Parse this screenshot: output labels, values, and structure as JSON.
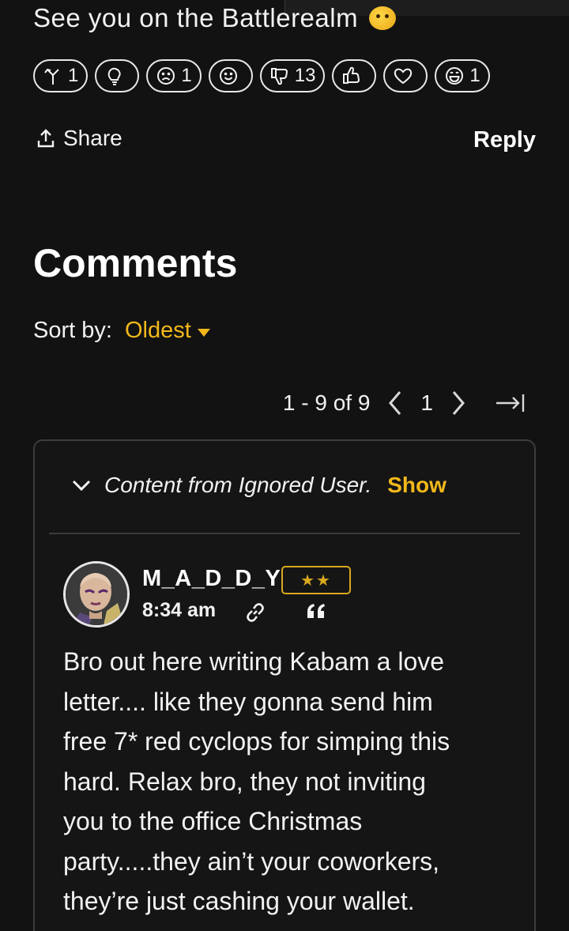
{
  "post": {
    "tail_text": "See you on the Battlerealm",
    "emoji": "partying-face-emoji"
  },
  "reactions": [
    {
      "name": "insightful",
      "icon": "arrow-fork-icon",
      "count": "1"
    },
    {
      "name": "idea",
      "icon": "lightbulb-icon",
      "count": ""
    },
    {
      "name": "sad",
      "icon": "frown-face-icon",
      "count": "1"
    },
    {
      "name": "smile",
      "icon": "smile-face-icon",
      "count": ""
    },
    {
      "name": "disagree",
      "icon": "thumbs-down-icon",
      "count": "13"
    },
    {
      "name": "like",
      "icon": "thumbs-up-icon",
      "count": ""
    },
    {
      "name": "love",
      "icon": "heart-icon",
      "count": ""
    },
    {
      "name": "lol",
      "icon": "grin-face-icon",
      "count": "1"
    }
  ],
  "actions": {
    "share_label": "Share",
    "reply_label": "Reply"
  },
  "comments": {
    "title": "Comments",
    "sort_label": "Sort by:",
    "sort_value": "Oldest"
  },
  "pagination": {
    "range": "1 - 9 of 9",
    "current_page": "1"
  },
  "ignored": {
    "text": "Content from Ignored User.",
    "show_label": "Show"
  },
  "comment": {
    "username": "M_A_D_D_Y",
    "rank": "★★",
    "time": "8:34 am",
    "lines": [
      "Bro out here writing Kabam a love",
      "letter.... like they gonna send him",
      "free 7* red cyclops for simping this",
      "hard. Relax bro, they not inviting",
      "you to the office Christmas",
      "party.....they ain’t your coworkers,",
      "they’re just cashing your wallet."
    ]
  },
  "colors": {
    "background": "#121212",
    "accent": "#f2b81b",
    "rank_gold": "#d9a81f"
  }
}
